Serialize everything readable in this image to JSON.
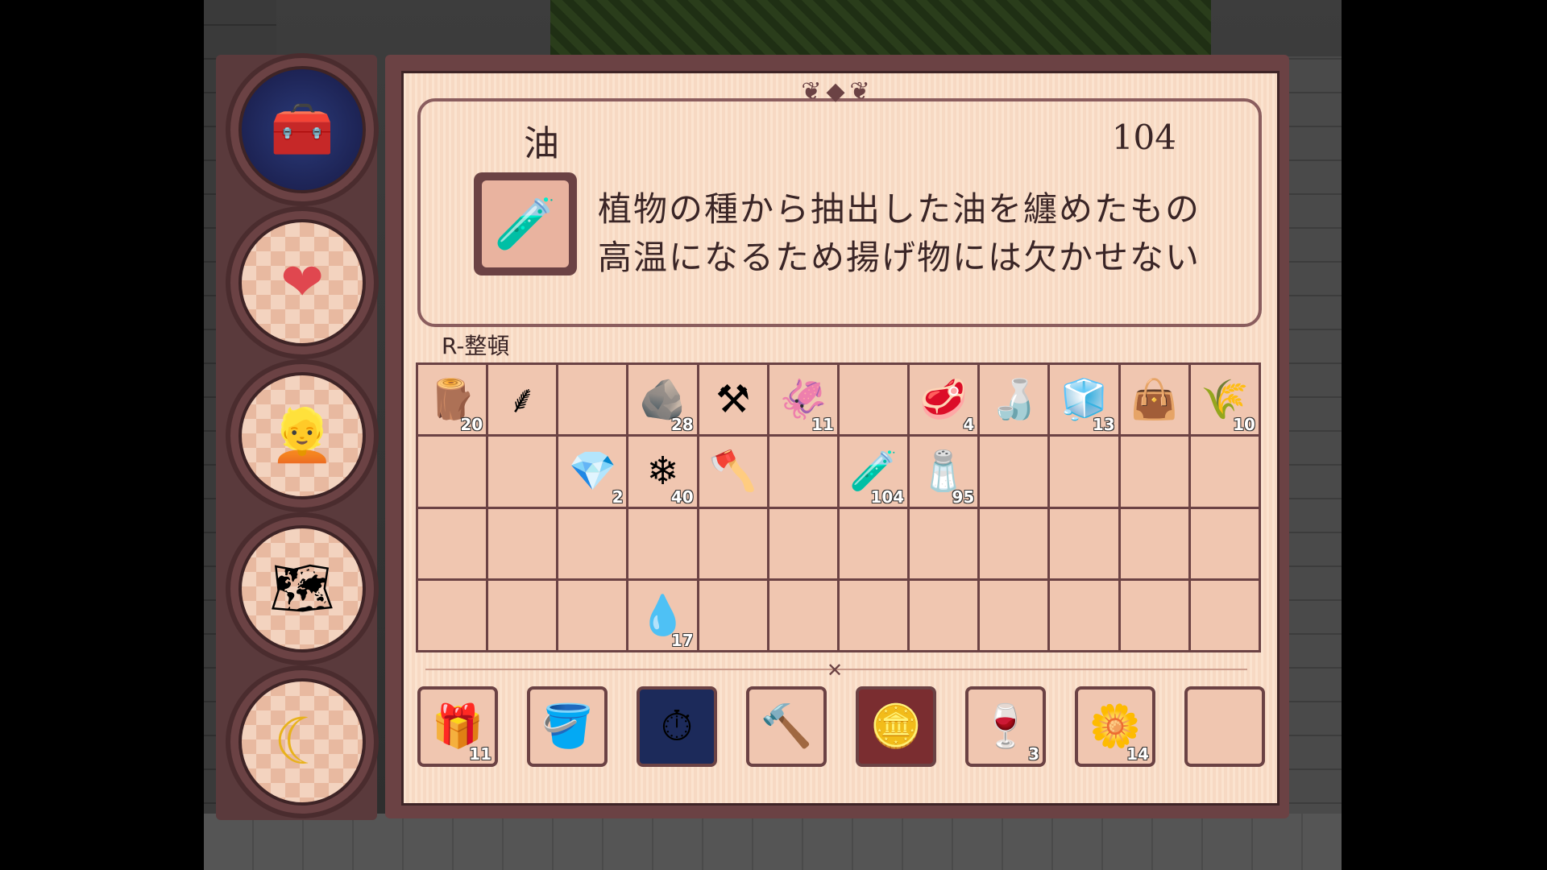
{
  "item": {
    "name": "油",
    "count": "104",
    "icon": "oil-bottle-icon",
    "description": [
      "植物の種から抽出した油を纏めたもの",
      "高温になるため揚げ物には欠かせない"
    ]
  },
  "sort_hint": "R-整頓",
  "side_tabs": [
    {
      "name": "inventory-chest",
      "icon": "chest-icon",
      "active": true
    },
    {
      "name": "heart",
      "icon": "heart-icon",
      "active": false
    },
    {
      "name": "character",
      "icon": "character-icon",
      "active": false
    },
    {
      "name": "map",
      "icon": "map-icon",
      "active": false
    },
    {
      "name": "sleep",
      "icon": "moon-icon",
      "active": false
    }
  ],
  "inventory": [
    [
      {
        "icon": "logs-icon",
        "count": "20"
      },
      {
        "icon": "scythe-icon",
        "count": ""
      },
      {
        "icon": "",
        "count": ""
      },
      {
        "icon": "stone-icon",
        "count": "28"
      },
      {
        "icon": "hoe-icon",
        "count": ""
      },
      {
        "icon": "squid-icon",
        "count": "11"
      },
      {
        "icon": "",
        "count": ""
      },
      {
        "icon": "meat-icon",
        "count": "4"
      },
      {
        "icon": "sauce-bottle-icon",
        "count": ""
      },
      {
        "icon": "ice-crystal-icon",
        "count": "13"
      },
      {
        "icon": "seed-bag-icon",
        "count": ""
      },
      {
        "icon": "flour-bag-icon",
        "count": "10"
      }
    ],
    [
      {
        "icon": "",
        "count": ""
      },
      {
        "icon": "",
        "count": ""
      },
      {
        "icon": "blue-ore-icon",
        "count": "2"
      },
      {
        "icon": "crystal-shards-icon",
        "count": "40"
      },
      {
        "icon": "axe-icon",
        "count": ""
      },
      {
        "icon": "",
        "count": ""
      },
      {
        "icon": "oil-bottle-icon",
        "count": "104"
      },
      {
        "icon": "salt-jar-icon",
        "count": "95"
      },
      {
        "icon": "",
        "count": ""
      },
      {
        "icon": "",
        "count": ""
      },
      {
        "icon": "",
        "count": ""
      },
      {
        "icon": "",
        "count": ""
      }
    ],
    [
      {
        "icon": "",
        "count": ""
      },
      {
        "icon": "",
        "count": ""
      },
      {
        "icon": "",
        "count": ""
      },
      {
        "icon": "",
        "count": ""
      },
      {
        "icon": "",
        "count": ""
      },
      {
        "icon": "",
        "count": ""
      },
      {
        "icon": "",
        "count": ""
      },
      {
        "icon": "",
        "count": ""
      },
      {
        "icon": "",
        "count": ""
      },
      {
        "icon": "",
        "count": ""
      },
      {
        "icon": "",
        "count": ""
      },
      {
        "icon": "",
        "count": ""
      }
    ],
    [
      {
        "icon": "",
        "count": ""
      },
      {
        "icon": "",
        "count": ""
      },
      {
        "icon": "",
        "count": ""
      },
      {
        "icon": "watering-can-icon",
        "count": "17"
      },
      {
        "icon": "",
        "count": ""
      },
      {
        "icon": "",
        "count": ""
      },
      {
        "icon": "",
        "count": ""
      },
      {
        "icon": "",
        "count": ""
      },
      {
        "icon": "",
        "count": ""
      },
      {
        "icon": "",
        "count": ""
      },
      {
        "icon": "",
        "count": ""
      },
      {
        "icon": "",
        "count": ""
      }
    ]
  ],
  "hotbar": [
    {
      "icon": "character-food-bag-icon",
      "count": "11"
    },
    {
      "icon": "bucket-icon",
      "count": ""
    },
    {
      "icon": "clock-fast-forward-icon",
      "count": ""
    },
    {
      "icon": "hammer-icon",
      "count": ""
    },
    {
      "icon": "coin-plus-icon",
      "count": ""
    },
    {
      "icon": "wine-bottle-icon",
      "count": "3"
    },
    {
      "icon": "yellow-flower-icon",
      "count": "14"
    },
    {
      "icon": "",
      "count": ""
    }
  ],
  "glyphs": {
    "chest-icon": "🧰",
    "heart-icon": "❤",
    "character-icon": "👱",
    "map-icon": "🗺",
    "moon-icon": "☾",
    "logs-icon": "🪵",
    "scythe-icon": "⸙",
    "stone-icon": "🪨",
    "hoe-icon": "⚒",
    "squid-icon": "🦑",
    "meat-icon": "🥩",
    "sauce-bottle-icon": "🍶",
    "ice-crystal-icon": "🧊",
    "seed-bag-icon": "👜",
    "flour-bag-icon": "🌾",
    "blue-ore-icon": "💎",
    "crystal-shards-icon": "❄",
    "axe-icon": "🪓",
    "oil-bottle-icon": "🧪",
    "salt-jar-icon": "🧂",
    "watering-can-icon": "💧",
    "character-food-bag-icon": "🎁",
    "bucket-icon": "🪣",
    "clock-fast-forward-icon": "⏱",
    "hammer-icon": "🔨",
    "coin-plus-icon": "🪙",
    "wine-bottle-icon": "🍷",
    "yellow-flower-icon": "🌼"
  }
}
